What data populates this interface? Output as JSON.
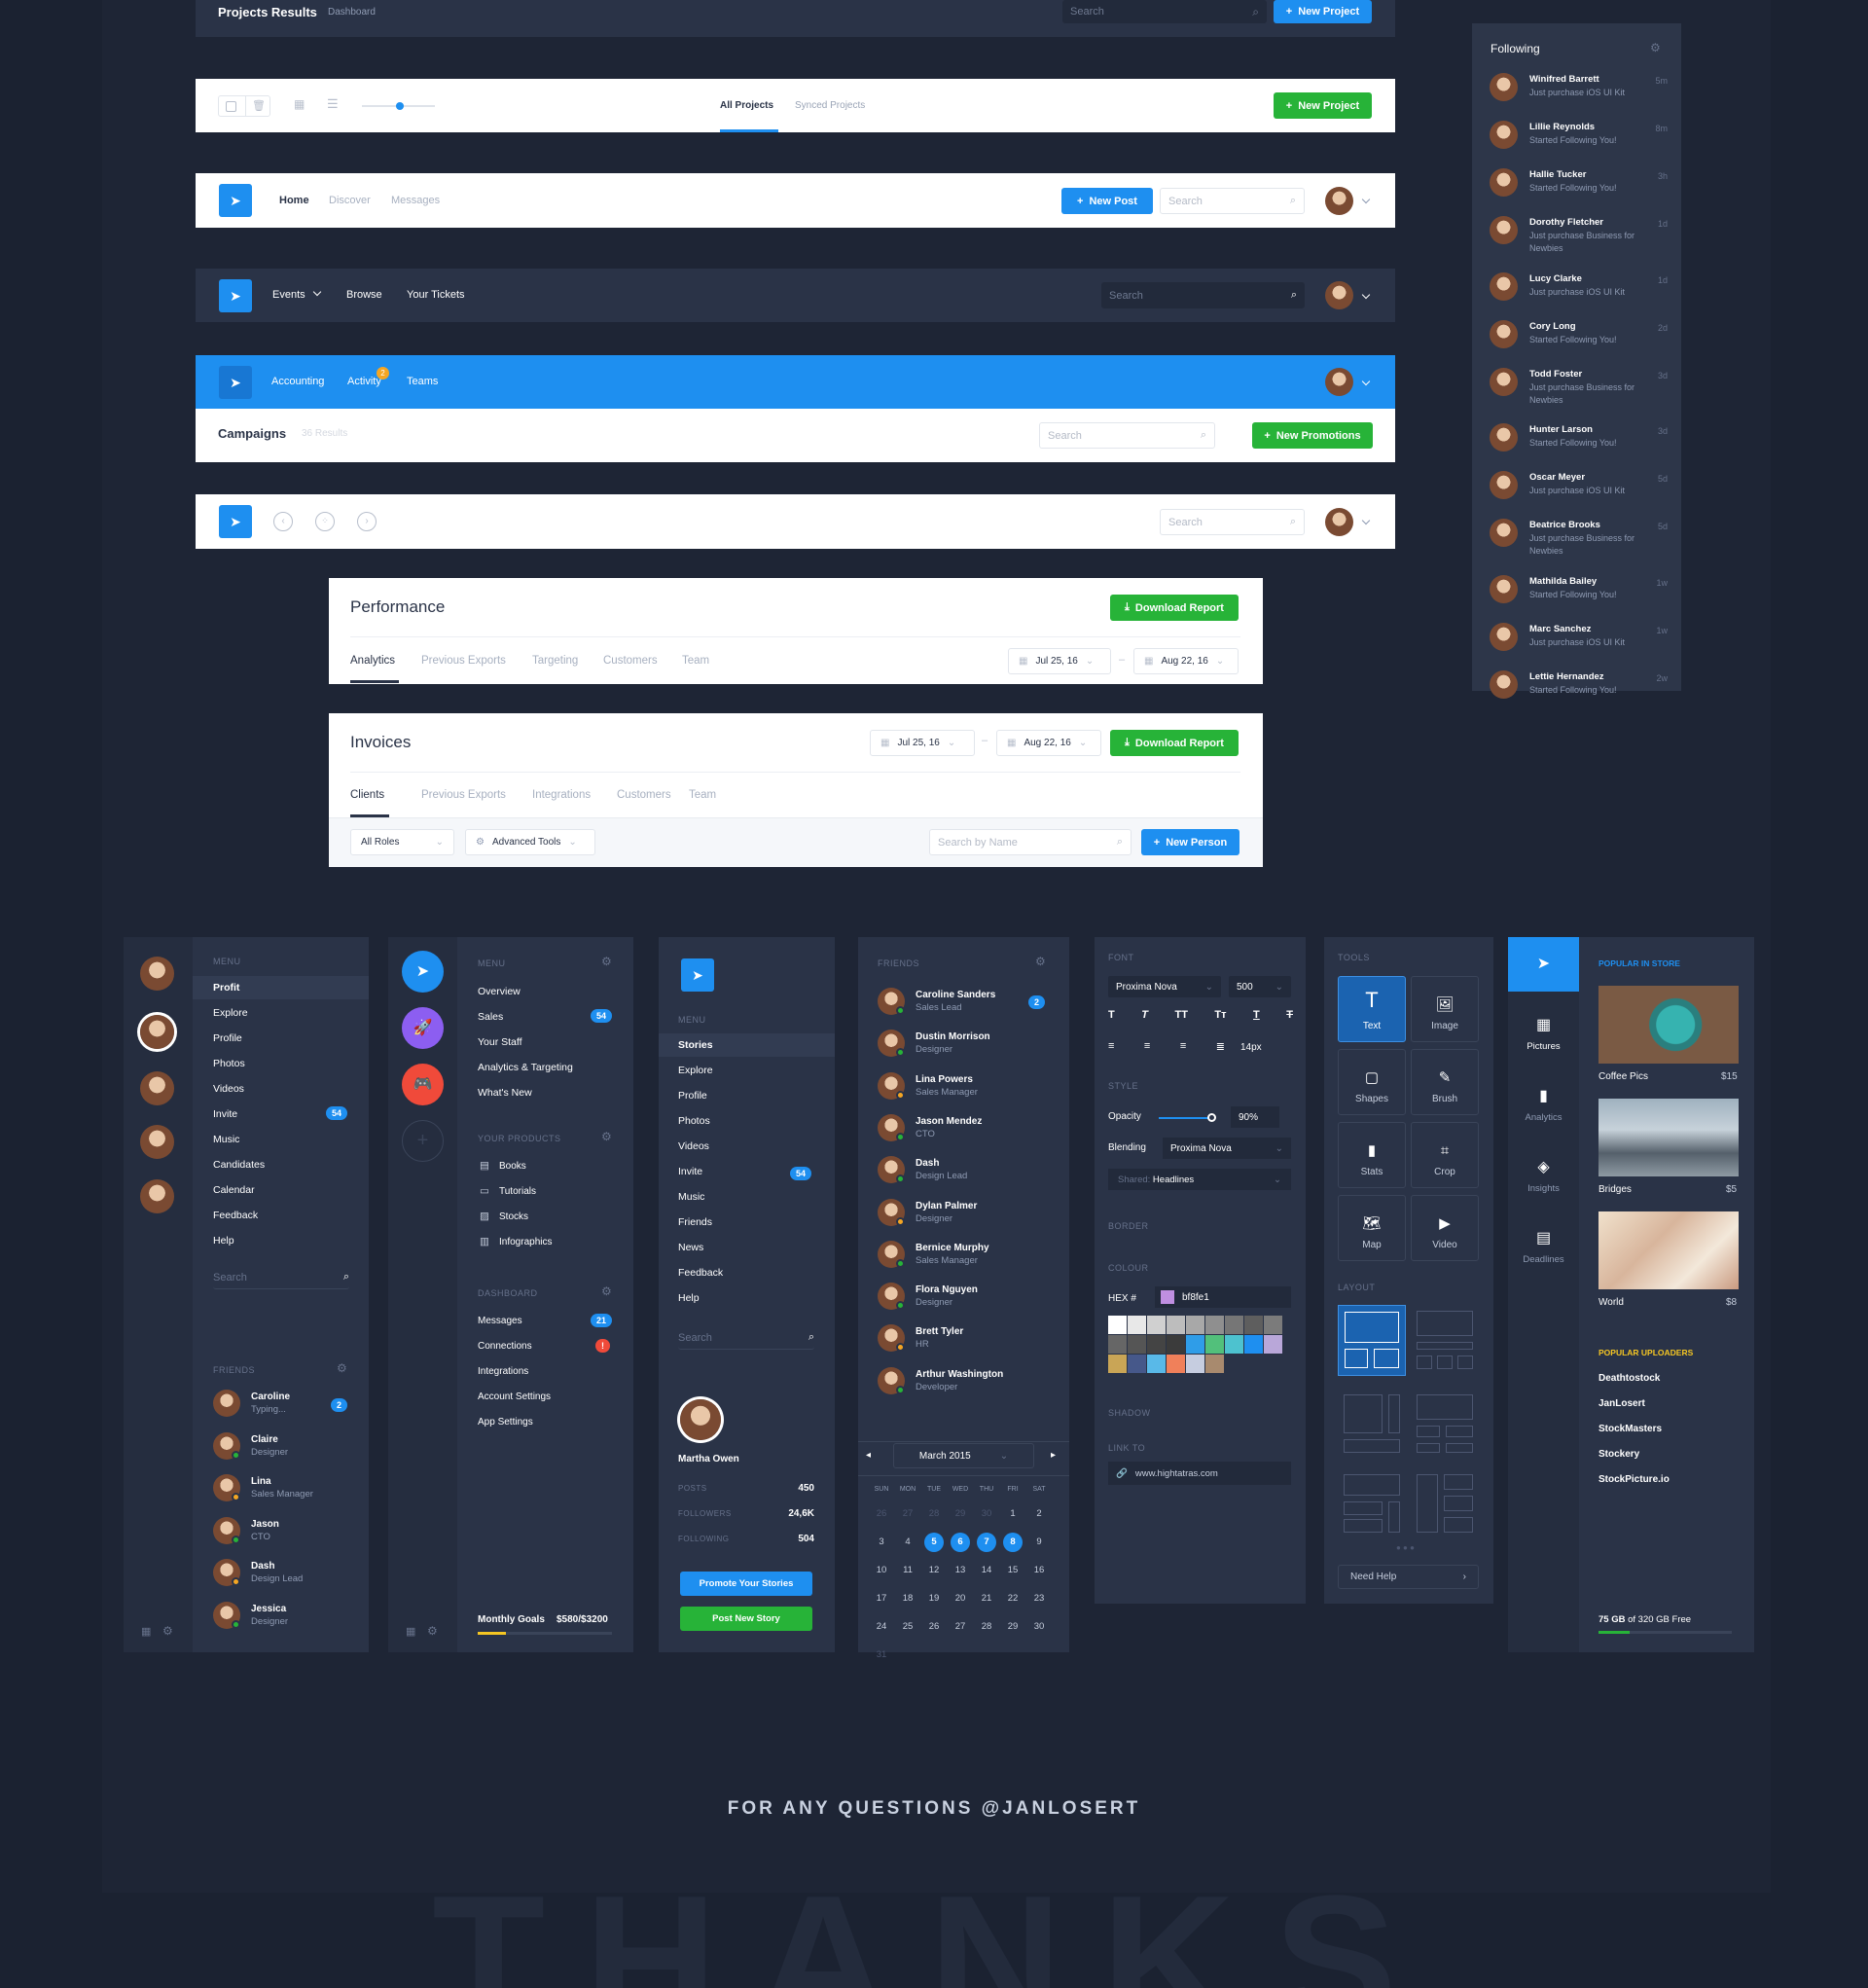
{
  "bar1": {
    "title": "Projects Results",
    "crumb": "Dashboard",
    "search": "Search",
    "button": "New Project"
  },
  "bar2": {
    "tabs": [
      "All Projects",
      "Synced Projects"
    ],
    "button": "New Project"
  },
  "bar3": {
    "nav": [
      "Home",
      "Discover",
      "Messages"
    ],
    "button": "New Post",
    "search": "Search"
  },
  "bar4": {
    "nav": [
      "Events",
      "Browse",
      "Your Tickets"
    ],
    "search": "Search"
  },
  "bar5": {
    "nav": [
      "Accounting",
      "Activity",
      "Teams"
    ],
    "activity_badge": "2",
    "title": "Campaigns",
    "results": "36 Results",
    "search": "Search",
    "button": "New Promotions"
  },
  "bar6": {
    "search": "Search"
  },
  "performance": {
    "title": "Performance",
    "button": "Download Report",
    "tabs": [
      "Analytics",
      "Previous Exports",
      "Targeting",
      "Customers",
      "Team"
    ],
    "date_from": "Jul 25, 16",
    "date_to": "Aug 22, 16"
  },
  "invoices": {
    "title": "Invoices",
    "date_from": "Jul 25, 16",
    "date_to": "Aug 22, 16",
    "button": "Download Report",
    "tabs": [
      "Clients",
      "Previous Exports",
      "Integrations",
      "Customers",
      "Team"
    ],
    "roles": "All Roles",
    "tools": "Advanced Tools",
    "search": "Search by Name",
    "new_person": "New Person"
  },
  "following": {
    "title": "Following",
    "items": [
      {
        "name": "Winifred Barrett",
        "sub": "Just purchase iOS UI Kit",
        "time": "5m"
      },
      {
        "name": "Lillie Reynolds",
        "sub": "Started Following You!",
        "time": "8m"
      },
      {
        "name": "Hallie Tucker",
        "sub": "Started Following You!",
        "time": "3h"
      },
      {
        "name": "Dorothy Fletcher",
        "sub": "Just purchase Business for Newbies",
        "time": "1d"
      },
      {
        "name": "Lucy Clarke",
        "sub": "Just purchase iOS UI Kit",
        "time": "1d"
      },
      {
        "name": "Cory Long",
        "sub": "Started Following You!",
        "time": "2d"
      },
      {
        "name": "Todd Foster",
        "sub": "Just purchase Business for Newbies",
        "time": "3d"
      },
      {
        "name": "Hunter Larson",
        "sub": "Started Following You!",
        "time": "3d"
      },
      {
        "name": "Oscar Meyer",
        "sub": "Just purchase iOS UI Kit",
        "time": "5d"
      },
      {
        "name": "Beatrice Brooks",
        "sub": "Just purchase Business for Newbies",
        "time": "5d"
      },
      {
        "name": "Mathilda Bailey",
        "sub": "Started Following You!",
        "time": "1w"
      },
      {
        "name": "Marc Sanchez",
        "sub": "Just purchase iOS UI Kit",
        "time": "1w"
      },
      {
        "name": "Lettie Hernandez",
        "sub": "Started Following You!",
        "time": "2w"
      }
    ]
  },
  "p1": {
    "menu_label": "Menu",
    "menu": [
      "Profit",
      "Explore",
      "Profile",
      "Photos",
      "Videos",
      "Invite",
      "Music",
      "Candidates",
      "Calendar",
      "Feedback",
      "Help"
    ],
    "invite_badge": "54",
    "search": "Search",
    "friends_label": "Friends",
    "friends": [
      {
        "name": "Caroline",
        "sub": "Typing..."
      },
      {
        "name": "Claire",
        "sub": "Designer"
      },
      {
        "name": "Lina",
        "sub": "Sales Manager"
      },
      {
        "name": "Jason",
        "sub": "CTO"
      },
      {
        "name": "Dash",
        "sub": "Design Lead"
      },
      {
        "name": "Jessica",
        "sub": "Designer"
      }
    ],
    "caroline_badge": "2"
  },
  "p2": {
    "menu_label": "Menu",
    "menu": [
      "Overview",
      "Sales",
      "Your Staff",
      "Analytics & Targeting",
      "What's New"
    ],
    "sales_badge": "54",
    "products_label": "Your Products",
    "products": [
      "Books",
      "Tutorials",
      "Stocks",
      "Infographics"
    ],
    "dash_label": "Dashboard",
    "dash": [
      "Messages",
      "Connections",
      "Integrations",
      "Account Settings",
      "App Settings"
    ],
    "messages_badge": "21",
    "integrations_badge": "!",
    "goals": "Monthly Goals",
    "goals_val": "$580/$3200"
  },
  "p3": {
    "menu_label": "Menu",
    "menu": [
      "Stories",
      "Explore",
      "Profile",
      "Photos",
      "Videos",
      "Invite",
      "Music",
      "Friends",
      "News",
      "Feedback",
      "Help"
    ],
    "invite_badge": "54",
    "search": "Search",
    "user": "Martha Owen",
    "stats": [
      {
        "k": "Posts",
        "v": "450"
      },
      {
        "k": "Followers",
        "v": "24,6K"
      },
      {
        "k": "Following",
        "v": "504"
      }
    ],
    "btn1": "Promote Your Stories",
    "btn2": "Post New Story"
  },
  "p4": {
    "friends_label": "Friends",
    "friends": [
      {
        "name": "Caroline Sanders",
        "sub": "Sales Lead"
      },
      {
        "name": "Dustin Morrison",
        "sub": "Designer"
      },
      {
        "name": "Lina Powers",
        "sub": "Sales Manager"
      },
      {
        "name": "Jason Mendez",
        "sub": "CTO"
      },
      {
        "name": "Dash",
        "sub": "Design Lead"
      },
      {
        "name": "Dylan Palmer",
        "sub": "Designer"
      },
      {
        "name": "Bernice Murphy",
        "sub": "Sales Manager"
      },
      {
        "name": "Flora Nguyen",
        "sub": "Designer"
      },
      {
        "name": "Brett Tyler",
        "sub": "HR"
      },
      {
        "name": "Arthur Washington",
        "sub": "Developer"
      }
    ],
    "caroline_badge": "2",
    "month": "March 2015",
    "days": [
      "SUN",
      "MON",
      "TUE",
      "WED",
      "THU",
      "FRI",
      "SAT"
    ],
    "cal": [
      "26",
      "27",
      "28",
      "29",
      "30",
      "1",
      "2",
      "3",
      "4",
      "5",
      "6",
      "7",
      "8",
      "9",
      "10",
      "11",
      "12",
      "13",
      "14",
      "15",
      "16",
      "17",
      "18",
      "19",
      "20",
      "21",
      "22",
      "23",
      "24",
      "25",
      "26",
      "27",
      "28",
      "29",
      "30",
      "31"
    ]
  },
  "p5": {
    "font_label": "Font",
    "font": "Proxima Nova",
    "weight": "500",
    "size": "14px",
    "style_label": "Style",
    "opacity_label": "Opacity",
    "opacity": "90%",
    "blending_label": "Blending",
    "blending": "Proxima Nova",
    "shared_label": "Shared:",
    "shared": "Headlines",
    "border_label": "Border",
    "colour_label": "Colour",
    "hex_label": "HEX #",
    "hex": "bf8fe1",
    "shadow_label": "Shadow",
    "link_label": "Link To",
    "link": "www.hightatras.com"
  },
  "p6": {
    "tools_label": "Tools",
    "tools": [
      "Text",
      "Image",
      "Shapes",
      "Brush",
      "Stats",
      "Crop",
      "Map",
      "Video"
    ],
    "layout_label": "Layout",
    "help": "Need Help"
  },
  "p7": {
    "side": [
      "Pictures",
      "Analytics",
      "Insights",
      "Deadlines"
    ],
    "popular_label": "Popular in Store",
    "items": [
      {
        "name": "Coffee Pics",
        "price": "$15"
      },
      {
        "name": "Bridges",
        "price": "$5"
      },
      {
        "name": "World",
        "price": "$8"
      }
    ],
    "uploaders_label": "Popular Uploaders",
    "uploaders": [
      "Deathtostock",
      "JanLosert",
      "StockMasters",
      "Stockery",
      "StockPicture.io"
    ],
    "storage_used": "75 GB",
    "storage_rest": "of 320 GB Free",
    "storage_fraction": 0.23
  },
  "footer": {
    "questions": "FOR ANY QUESTIONS @JANLOSERT",
    "thanks": "THANKS"
  },
  "colors": {
    "accent": "#1e8ff0",
    "green": "#27b338",
    "dark_panel": "#2a3347",
    "bg": "#1b2231"
  }
}
